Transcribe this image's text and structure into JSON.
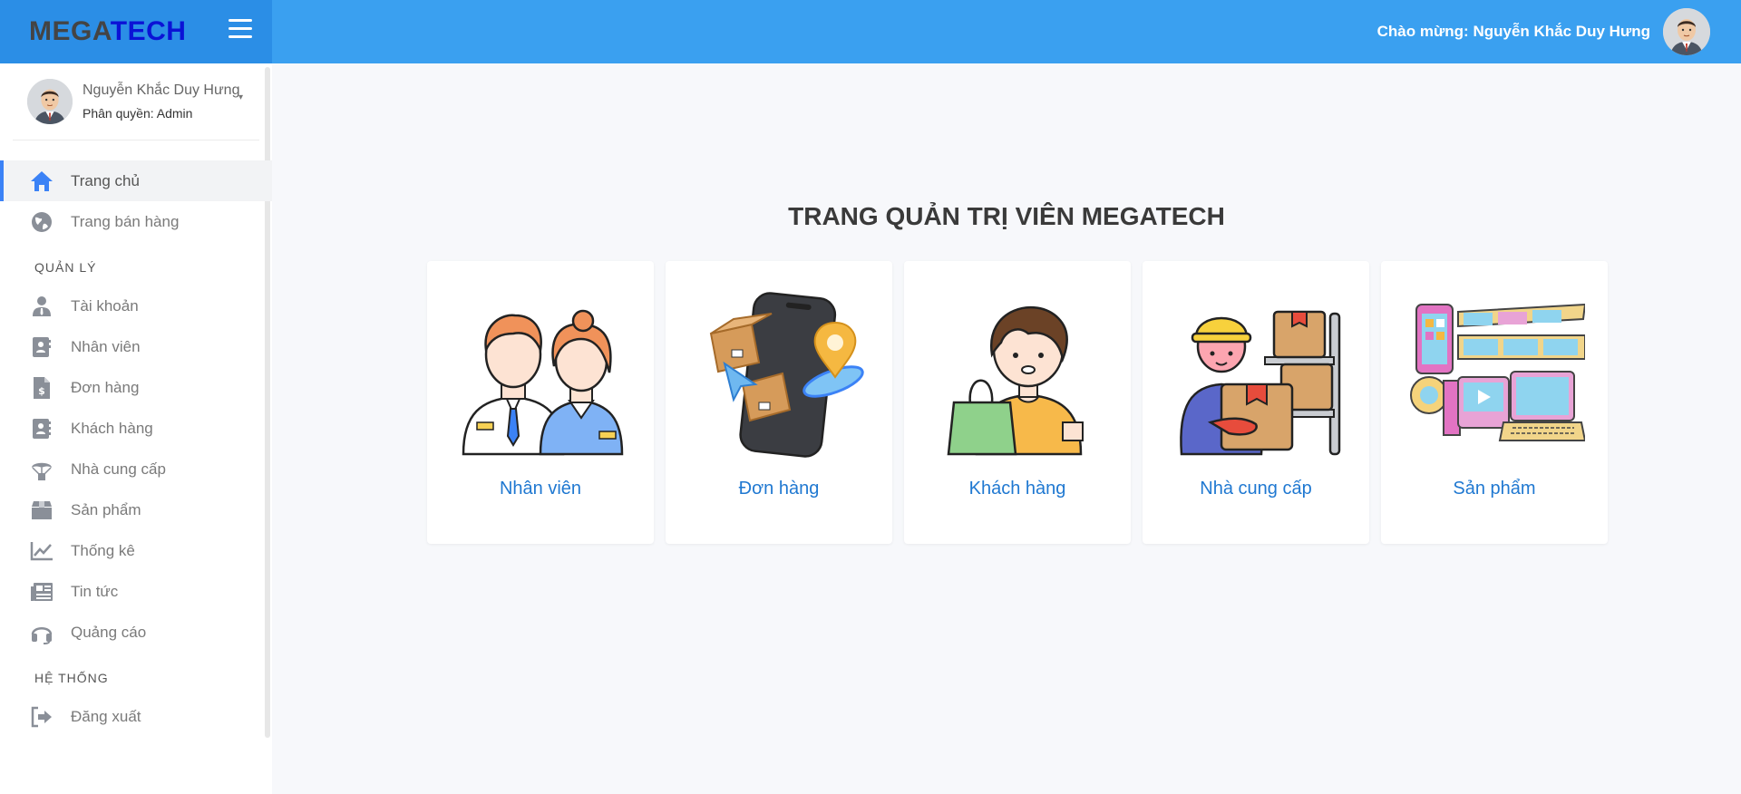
{
  "brand": {
    "mega": "MEGA",
    "tech": "TECH"
  },
  "header": {
    "welcome": "Chào mừng: Nguyễn Khắc Duy Hưng"
  },
  "profile": {
    "name": "Nguyễn Khắc Duy Hưng",
    "role": "Phân quyền: Admin"
  },
  "sidebar": {
    "top_items": [
      {
        "label": "Trang chủ",
        "icon": "home-icon",
        "active": true
      },
      {
        "label": "Trang bán hàng",
        "icon": "globe-icon"
      }
    ],
    "section_manage": "QUẢN LÝ",
    "manage_items": [
      {
        "label": "Tài khoản",
        "icon": "user-icon"
      },
      {
        "label": "Nhân viên",
        "icon": "id-card-icon"
      },
      {
        "label": "Đơn hàng",
        "icon": "invoice-dollar-icon"
      },
      {
        "label": "Khách hàng",
        "icon": "contact-card-icon"
      },
      {
        "label": "Nhà cung cấp",
        "icon": "parachute-box-icon"
      },
      {
        "label": "Sản phẩm",
        "icon": "box-icon"
      },
      {
        "label": "Thống kê",
        "icon": "line-chart-icon"
      },
      {
        "label": "Tin tức",
        "icon": "newspaper-icon"
      },
      {
        "label": "Quảng cáo",
        "icon": "headset-icon"
      }
    ],
    "section_system": "HỆ THỐNG",
    "system_items": [
      {
        "label": "Đăng xuất",
        "icon": "sign-out-icon"
      }
    ]
  },
  "main": {
    "title": "TRANG QUẢN TRỊ VIÊN MEGATECH",
    "cards": [
      {
        "label": "Nhân viên",
        "icon": "employees-illustration"
      },
      {
        "label": "Đơn hàng",
        "icon": "orders-illustration"
      },
      {
        "label": "Khách hàng",
        "icon": "customer-illustration"
      },
      {
        "label": "Nhà cung cấp",
        "icon": "supplier-illustration"
      },
      {
        "label": "Sản phẩm",
        "icon": "products-illustration"
      }
    ]
  },
  "colors": {
    "brand_bg": "#2b8ee6",
    "topbar_bg": "#3aa0f0",
    "accent": "#3b82f6",
    "card_label": "#1f78d1"
  }
}
